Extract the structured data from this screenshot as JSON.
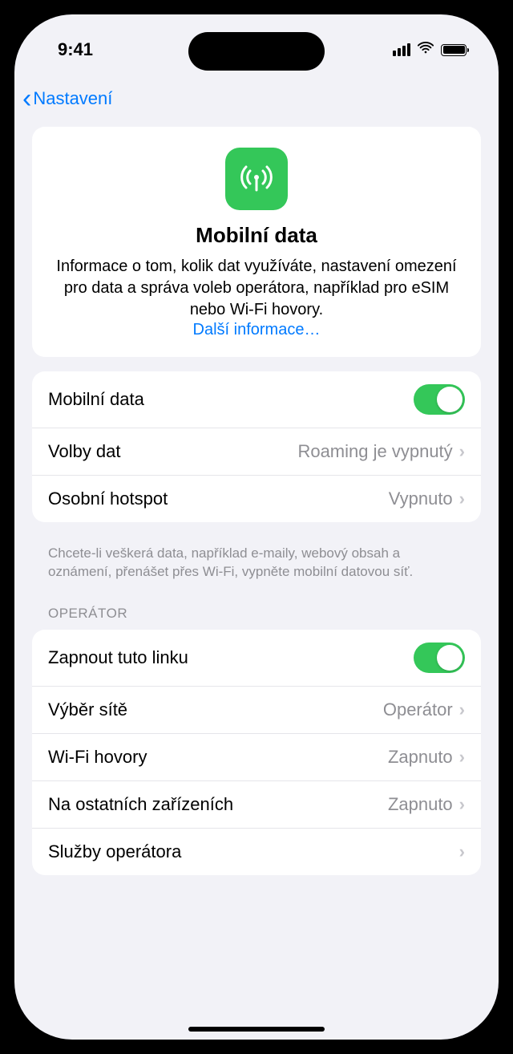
{
  "status": {
    "time": "9:41"
  },
  "nav": {
    "back_label": "Nastavení"
  },
  "hero": {
    "title": "Mobilní data",
    "description": "Informace o tom, kolik dat využíváte, nastavení omezení pro data a správa voleb operátora, například pro eSIM nebo Wi-Fi hovory.",
    "link": "Další informace…"
  },
  "group1": {
    "cellular_data": {
      "label": "Mobilní data",
      "on": true
    },
    "data_options": {
      "label": "Volby dat",
      "value": "Roaming je vypnutý"
    },
    "hotspot": {
      "label": "Osobní hotspot",
      "value": "Vypnuto"
    },
    "footer": "Chcete-li veškerá data, například e-maily, webový obsah a oznámení, přenášet přes Wi-Fi, vypněte mobilní datovou síť."
  },
  "operator_section": {
    "header": "OPERÁTOR",
    "turn_on_line": {
      "label": "Zapnout tuto linku",
      "on": true
    },
    "network_selection": {
      "label": "Výběr sítě",
      "value": "Operátor"
    },
    "wifi_calling": {
      "label": "Wi-Fi hovory",
      "value": "Zapnuto"
    },
    "other_devices": {
      "label": "Na ostatních zařízeních",
      "value": "Zapnuto"
    },
    "carrier_services": {
      "label": "Služby operátora",
      "value": ""
    }
  }
}
